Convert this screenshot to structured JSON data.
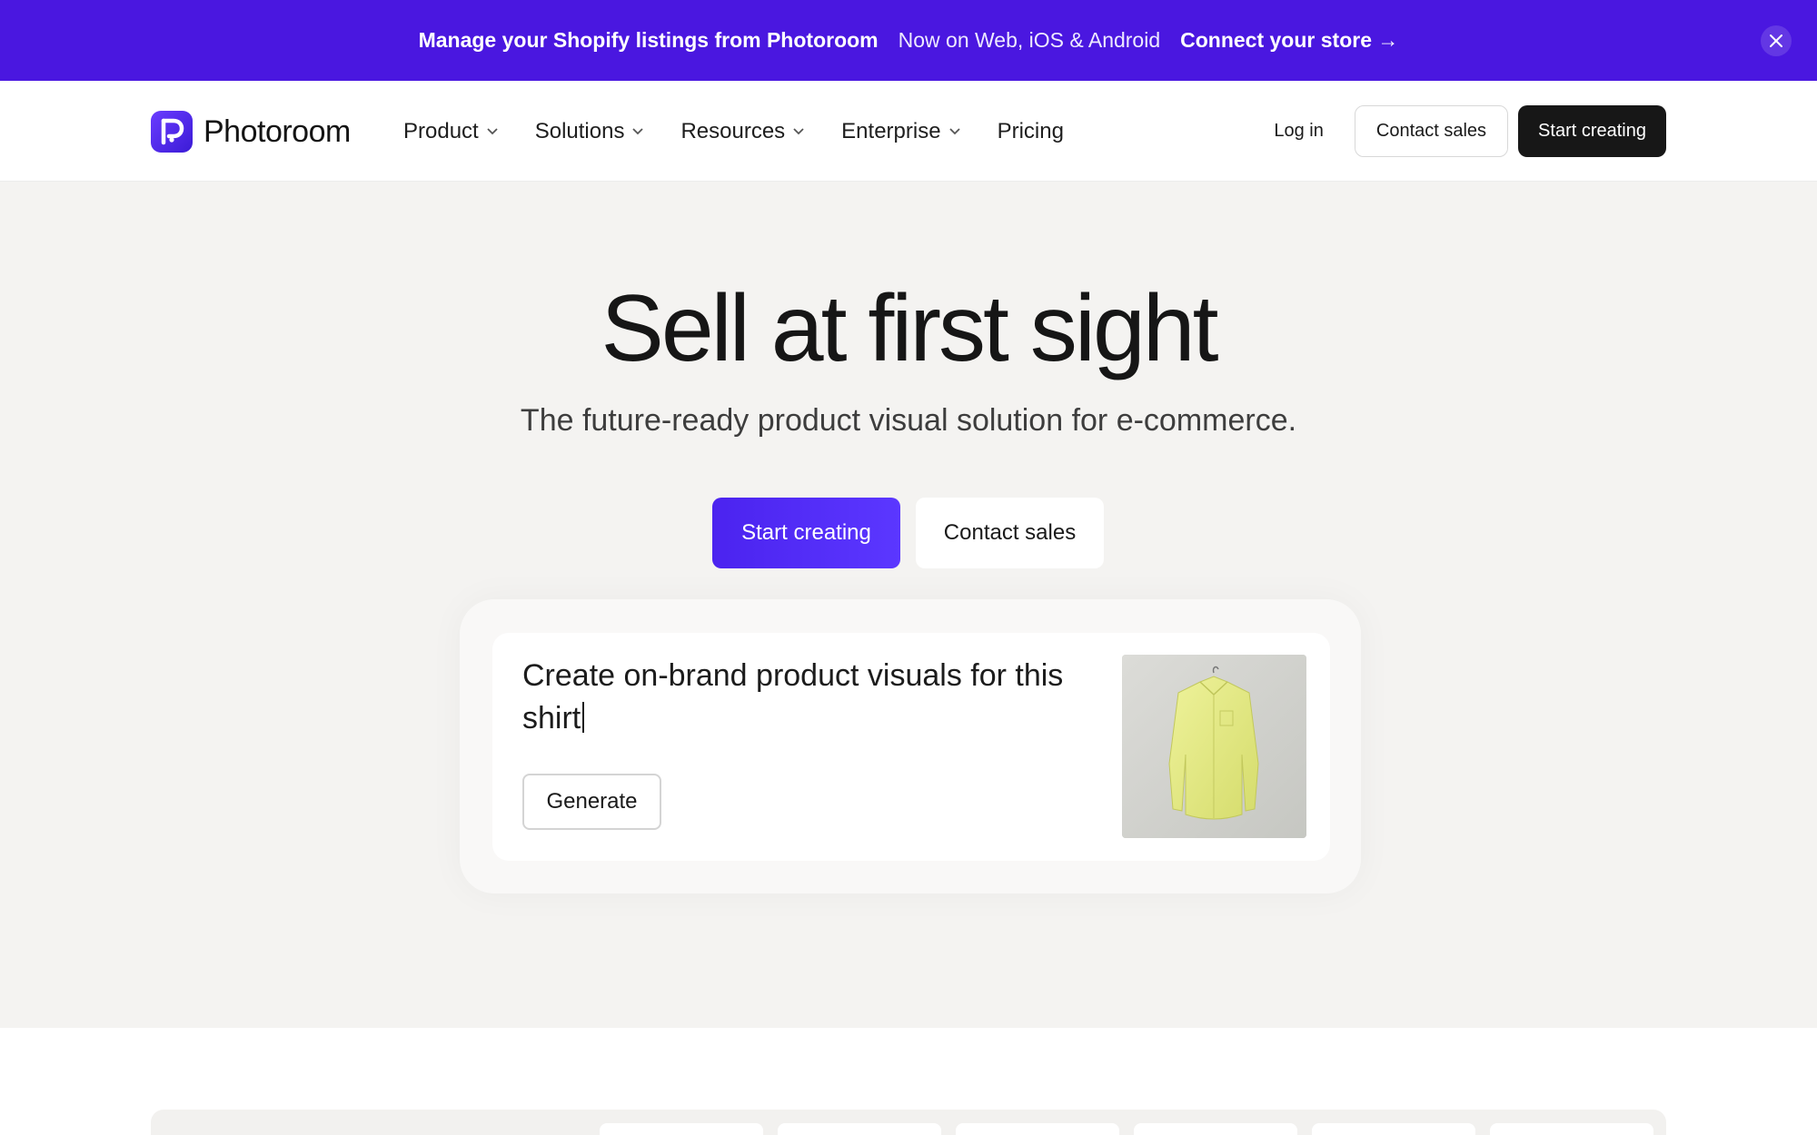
{
  "announcement": {
    "text_bold": "Manage your Shopify listings from Photoroom",
    "text_light": "Now on Web, iOS & Android",
    "link": "Connect your store →",
    "close_icon": "close-icon"
  },
  "header": {
    "brand": "Photoroom",
    "nav": [
      {
        "label": "Product",
        "has_menu": true
      },
      {
        "label": "Solutions",
        "has_menu": true
      },
      {
        "label": "Resources",
        "has_menu": true
      },
      {
        "label": "Enterprise",
        "has_menu": true
      },
      {
        "label": "Pricing",
        "has_menu": false
      }
    ],
    "login": "Log in",
    "contact_sales": "Contact sales",
    "start_creating": "Start creating"
  },
  "hero": {
    "title": "Sell at first sight",
    "subtitle": "The future-ready product visual solution for e-commerce.",
    "primary_cta": "Start creating",
    "secondary_cta": "Contact sales"
  },
  "prompt_card": {
    "prompt": "Create on-brand product visuals for this shirt",
    "button": "Generate",
    "image_subject": "yellow shirt on hanger"
  },
  "colors": {
    "brand": "#4a17e0",
    "primary_button": "#4b23ef",
    "dark_button": "#171717",
    "page_bg": "#f4f3f1"
  }
}
